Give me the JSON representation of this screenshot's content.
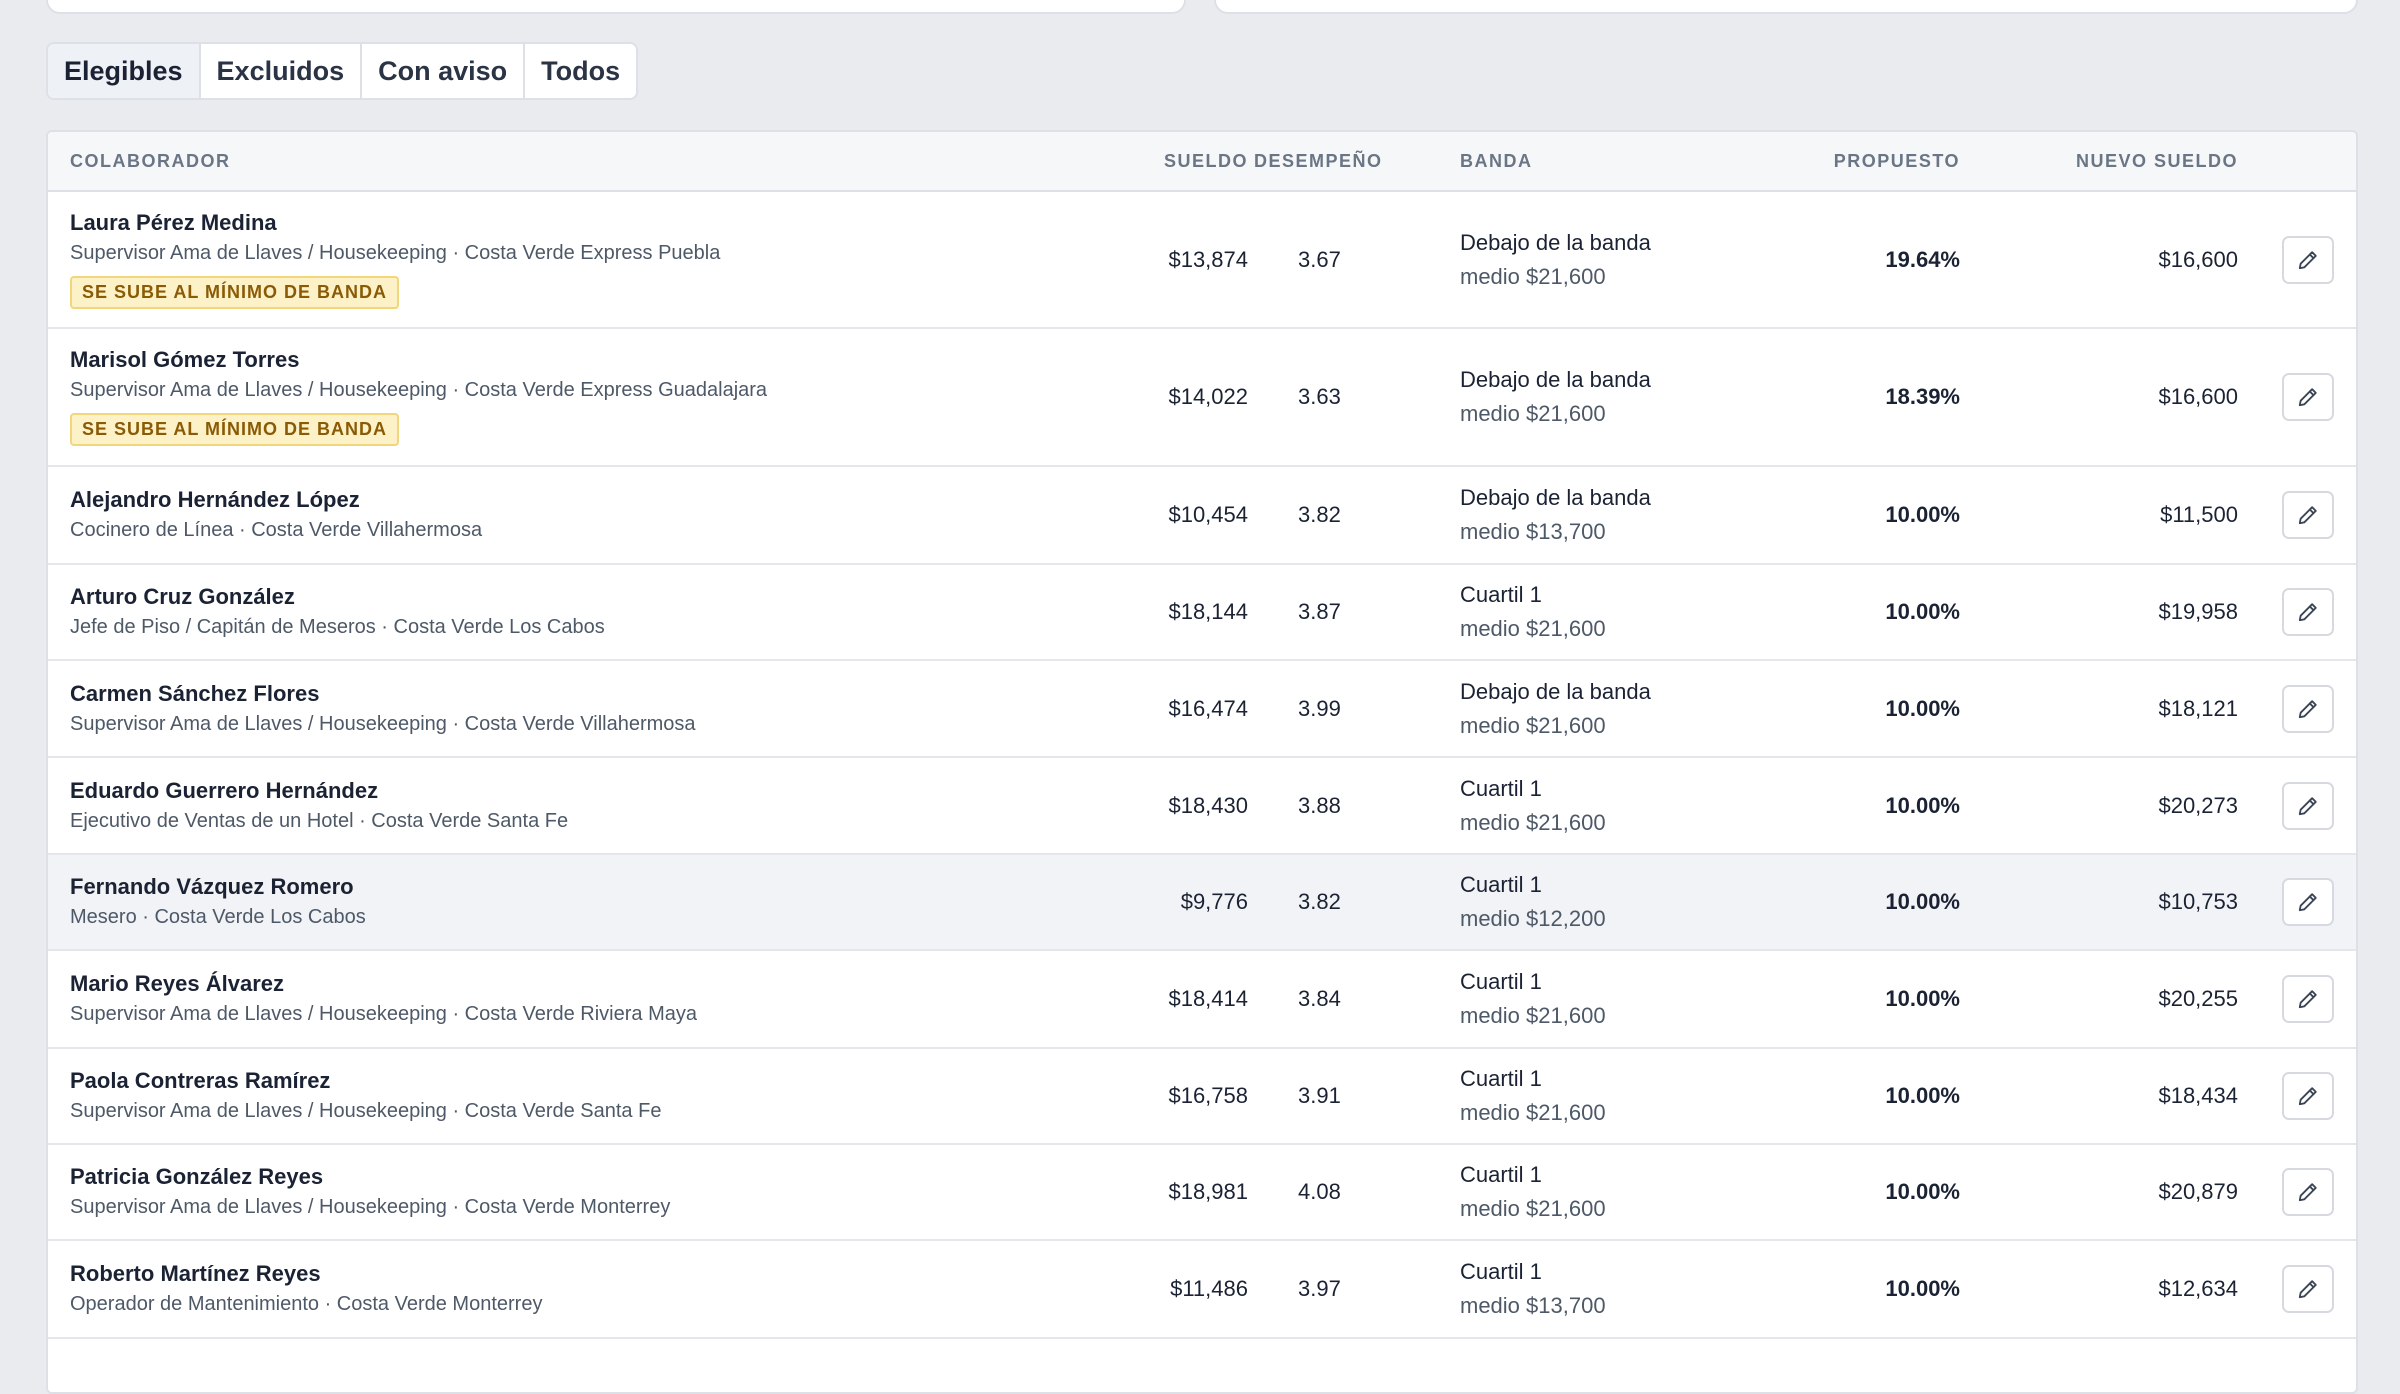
{
  "tabs": [
    {
      "label": "Elegibles"
    },
    {
      "label": "Excluidos"
    },
    {
      "label": "Con aviso"
    },
    {
      "label": "Todos"
    }
  ],
  "columns": {
    "colaborador": "COLABORADOR",
    "sueldo": "SUELDO",
    "desempeno": "DESEMPEÑO",
    "banda": "BANDA",
    "propuesto": "PROPUESTO",
    "nuevo_sueldo": "NUEVO SUELDO"
  },
  "flag_label": "SE SUBE AL MÍNIMO DE BANDA",
  "colors": {
    "accent_flag_bg": "#fdf1c7",
    "accent_flag_text": "#8a5a05",
    "hover_row": "#f1f3f6"
  },
  "rows": [
    {
      "name": "Laura Pérez Medina",
      "subtitle": "Supervisor Ama de Llaves / Housekeeping · Costa Verde Express Puebla",
      "salary": "$13,874",
      "performance": "3.67",
      "band_status": "Debajo de la banda",
      "band_mid": "medio $21,600",
      "proposed": "19.64%",
      "new_salary": "$16,600",
      "flag": true
    },
    {
      "name": "Marisol Gómez Torres",
      "subtitle": "Supervisor Ama de Llaves / Housekeeping · Costa Verde Express Guadalajara",
      "salary": "$14,022",
      "performance": "3.63",
      "band_status": "Debajo de la banda",
      "band_mid": "medio $21,600",
      "proposed": "18.39%",
      "new_salary": "$16,600",
      "flag": true
    },
    {
      "name": "Alejandro Hernández López",
      "subtitle": "Cocinero de Línea · Costa Verde Villahermosa",
      "salary": "$10,454",
      "performance": "3.82",
      "band_status": "Debajo de la banda",
      "band_mid": "medio $13,700",
      "proposed": "10.00%",
      "new_salary": "$11,500",
      "flag": false
    },
    {
      "name": "Arturo Cruz González",
      "subtitle": "Jefe de Piso / Capitán de Meseros · Costa Verde Los Cabos",
      "salary": "$18,144",
      "performance": "3.87",
      "band_status": "Cuartil 1",
      "band_mid": "medio $21,600",
      "proposed": "10.00%",
      "new_salary": "$19,958",
      "flag": false
    },
    {
      "name": "Carmen Sánchez Flores",
      "subtitle": "Supervisor Ama de Llaves / Housekeeping · Costa Verde Villahermosa",
      "salary": "$16,474",
      "performance": "3.99",
      "band_status": "Debajo de la banda",
      "band_mid": "medio $21,600",
      "proposed": "10.00%",
      "new_salary": "$18,121",
      "flag": false
    },
    {
      "name": "Eduardo Guerrero Hernández",
      "subtitle": "Ejecutivo de Ventas de un Hotel · Costa Verde Santa Fe",
      "salary": "$18,430",
      "performance": "3.88",
      "band_status": "Cuartil 1",
      "band_mid": "medio $21,600",
      "proposed": "10.00%",
      "new_salary": "$20,273",
      "flag": false
    },
    {
      "name": "Fernando Vázquez Romero",
      "subtitle": "Mesero · Costa Verde Los Cabos",
      "salary": "$9,776",
      "performance": "3.82",
      "band_status": "Cuartil 1",
      "band_mid": "medio $12,200",
      "proposed": "10.00%",
      "new_salary": "$10,753",
      "flag": false
    },
    {
      "name": "Mario Reyes Álvarez",
      "subtitle": "Supervisor Ama de Llaves / Housekeeping · Costa Verde Riviera Maya",
      "salary": "$18,414",
      "performance": "3.84",
      "band_status": "Cuartil 1",
      "band_mid": "medio $21,600",
      "proposed": "10.00%",
      "new_salary": "$20,255",
      "flag": false
    },
    {
      "name": "Paola Contreras Ramírez",
      "subtitle": "Supervisor Ama de Llaves / Housekeeping · Costa Verde Santa Fe",
      "salary": "$16,758",
      "performance": "3.91",
      "band_status": "Cuartil 1",
      "band_mid": "medio $21,600",
      "proposed": "10.00%",
      "new_salary": "$18,434",
      "flag": false
    },
    {
      "name": "Patricia González Reyes",
      "subtitle": "Supervisor Ama de Llaves / Housekeeping · Costa Verde Monterrey",
      "salary": "$18,981",
      "performance": "4.08",
      "band_status": "Cuartil 1",
      "band_mid": "medio $21,600",
      "proposed": "10.00%",
      "new_salary": "$20,879",
      "flag": false
    },
    {
      "name": "Roberto Martínez Reyes",
      "subtitle": "Operador de Mantenimiento · Costa Verde Monterrey",
      "salary": "$11,486",
      "performance": "3.97",
      "band_status": "Cuartil 1",
      "band_mid": "medio $13,700",
      "proposed": "10.00%",
      "new_salary": "$12,634",
      "flag": false
    }
  ]
}
